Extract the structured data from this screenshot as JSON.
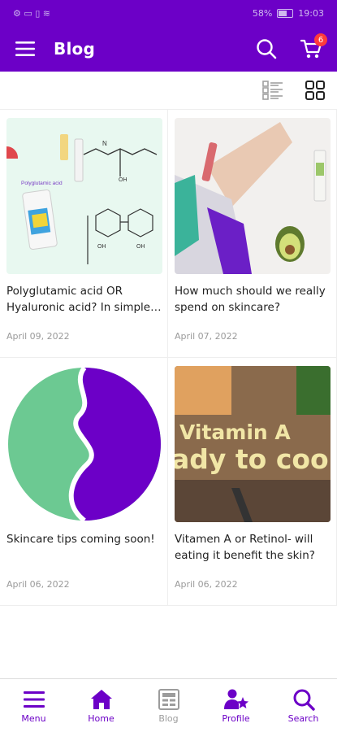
{
  "status_bar": {
    "left_text": "⚙ ▭ ▯ ≋",
    "battery": "58%",
    "time": "19:03"
  },
  "app_bar": {
    "title": "Blog",
    "cart_count": "6",
    "icons": [
      "menu-icon",
      "search-icon",
      "cart-icon"
    ]
  },
  "view_toggle": {
    "options": [
      "list-view-icon",
      "grid-view-icon"
    ],
    "selected": "grid"
  },
  "posts": [
    {
      "title": "Polyglutamic acid OR Hyaluronic acid? In simple terms",
      "date": "April 09, 2022",
      "thumb_label": "Polyglutamic acid"
    },
    {
      "title": "How much should we really spend on skincare?",
      "date": "April 07, 2022"
    },
    {
      "title": "Skincare tips coming soon!",
      "date": "April 06, 2022"
    },
    {
      "title": "Vitamen A or Retinol- will eating it benefit the skin?",
      "date": "April 06, 2022",
      "thumb_line1": "Vitamin A",
      "thumb_line2": "ady to cook"
    }
  ],
  "bottom_nav": [
    {
      "label": "Menu",
      "icon": "menu-icon",
      "active": true
    },
    {
      "label": "Home",
      "icon": "home-icon",
      "active": true
    },
    {
      "label": "Blog",
      "icon": "blog-icon",
      "active": false
    },
    {
      "label": "Profile",
      "icon": "profile-star-icon",
      "active": true
    },
    {
      "label": "Search",
      "icon": "search-icon",
      "active": true
    }
  ],
  "colors": {
    "brand": "#6c00c7",
    "badge": "#ff3b3b",
    "inactive": "#9c9c9c",
    "accent_green": "#6cc992"
  }
}
